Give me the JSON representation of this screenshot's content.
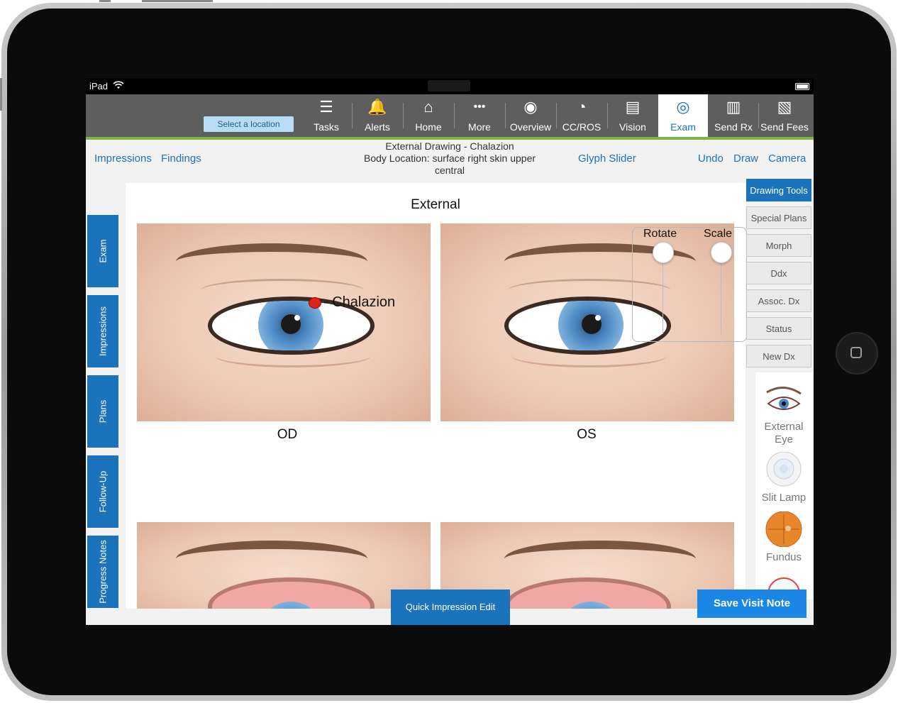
{
  "status_bar": {
    "device": "iPad"
  },
  "top_nav": {
    "location_button": "Select a location",
    "items": [
      {
        "label": "Tasks",
        "icon": "tasks-icon",
        "glyph": "☰"
      },
      {
        "label": "Alerts",
        "icon": "bell-icon",
        "glyph": "🔔"
      },
      {
        "label": "Home",
        "icon": "home-icon",
        "glyph": "⌂"
      },
      {
        "label": "More",
        "icon": "more-icon",
        "glyph": "•••"
      },
      {
        "label": "Overview",
        "icon": "person-icon",
        "glyph": "◉"
      },
      {
        "label": "CC/ROS",
        "icon": "clock-icon",
        "glyph": "◔"
      },
      {
        "label": "Vision",
        "icon": "vision-chart-icon",
        "glyph": "▤"
      },
      {
        "label": "Exam",
        "icon": "eye-icon",
        "glyph": "◎",
        "active": true
      },
      {
        "label": "Send Rx",
        "icon": "send-rx-icon",
        "glyph": "▥"
      },
      {
        "label": "Send Fees",
        "icon": "send-fees-icon",
        "glyph": "▧"
      }
    ]
  },
  "sub_bar": {
    "impressions": "Impressions",
    "findings": "Findings",
    "drawing_title": "External Drawing - Chalazion",
    "body_location": "Body Location: surface right skin upper central",
    "glyph_slider": "Glyph Slider",
    "undo": "Undo",
    "draw": "Draw",
    "camera": "Camera"
  },
  "left_rail": [
    "Exam",
    "Impressions",
    "Plans",
    "Follow-Up",
    "Progress Notes"
  ],
  "canvas": {
    "title": "External",
    "od_label": "OD",
    "os_label": "OS",
    "marker_label": "- Chalazion",
    "rotate_label": "Rotate",
    "scale_label": "Scale"
  },
  "right_tabs": [
    "Drawing Tools",
    "Special Plans",
    "Morph",
    "Ddx",
    "Assoc. Dx",
    "Status",
    "New Dx"
  ],
  "palette": [
    {
      "label": "External Eye",
      "icon": "external-eye-icon"
    },
    {
      "label": "Slit Lamp",
      "icon": "slit-lamp-icon"
    },
    {
      "label": "Fundus",
      "icon": "fundus-icon"
    }
  ],
  "buttons": {
    "quick_impression": "Quick Impression Edit",
    "save_visit": "Save Visit Note"
  },
  "colors": {
    "primary_blue": "#1b74bb",
    "nav_gray": "#5e5e5e",
    "accent_green": "#79b943",
    "marker_red": "#e0241b"
  }
}
